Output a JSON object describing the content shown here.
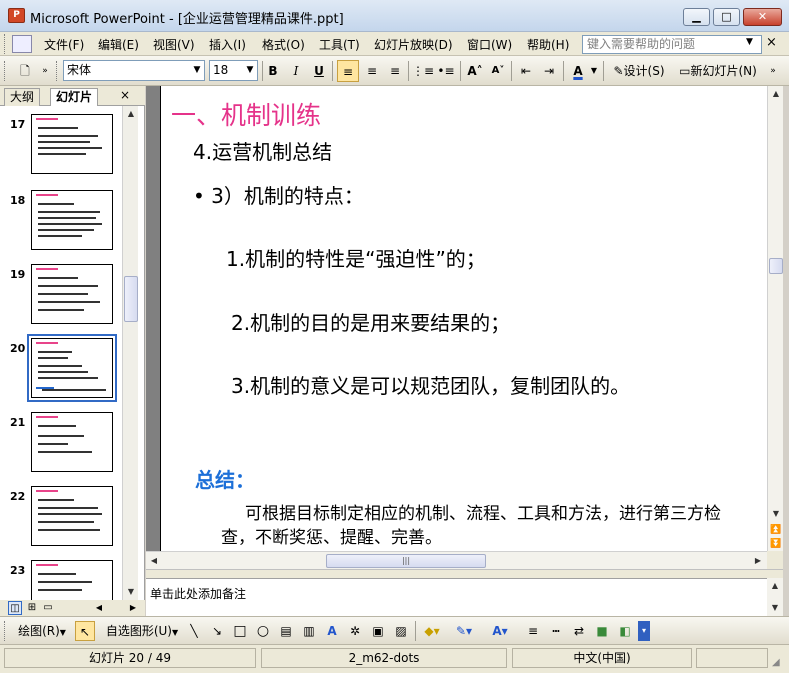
{
  "window": {
    "app_icon_text": "P",
    "title": "Microsoft PowerPoint - [企业运营管理精品课件.ppt]",
    "min_glyph": "▁",
    "max_glyph": "□",
    "close_glyph": "✕"
  },
  "menu": {
    "items": [
      "文件(F)",
      "编辑(E)",
      "视图(V)",
      "插入(I)",
      "格式(O)",
      "工具(T)",
      "幻灯片放映(D)",
      "窗口(W)",
      "帮助(H)"
    ],
    "help_placeholder": "键入需要帮助的问题",
    "close_glyph": "×"
  },
  "format_toolbar": {
    "font": "宋体",
    "size": "18",
    "bold": "B",
    "italic": "I",
    "underline": "U",
    "design_label": "设计(S)",
    "new_slide_label": "新幻灯片(N)"
  },
  "panel": {
    "tab_outline": "大纲",
    "tab_slides": "幻灯片",
    "close_glyph": "×",
    "slide_numbers": [
      "17",
      "18",
      "19",
      "20",
      "21",
      "22",
      "23"
    ],
    "selected_slide": "20"
  },
  "slide": {
    "title": "一、机制训练",
    "subtitle": "4.运营机制总结",
    "bullet": "•  3）机制的特点：",
    "items": [
      "1.机制的特性是“强迫性”的；",
      "2.机制的目的是用来要结果的；",
      "3.机制的意义是可以规范团队，复制团队的。"
    ],
    "summary_label": "总结：",
    "summary_line1": "可根据目标制定相应的机制、流程、工具和方法，进行第三方检",
    "summary_line2": "查，不断奖惩、提醒、完善。"
  },
  "notes": {
    "placeholder": "单击此处添加备注"
  },
  "draw_toolbar": {
    "draw_label": "绘图(R)",
    "autoshape_label": "自选图形(U)"
  },
  "status": {
    "slide_pos": "幻灯片 20 / 49",
    "template": "2_m62-dots",
    "language": "中文(中国)"
  },
  "colors": {
    "title_pink": "#e5338a",
    "summary_blue": "#1c6fd8",
    "selection_blue": "#316ac5"
  }
}
